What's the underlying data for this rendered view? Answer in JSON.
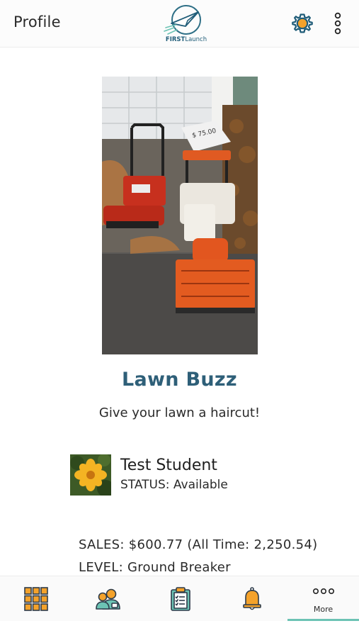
{
  "header": {
    "title": "Profile",
    "logo_text_bold": "FIRST",
    "logo_text_rest": "Launch"
  },
  "business": {
    "name": "Lawn Buzz",
    "tagline": "Give your lawn a haircut!"
  },
  "student": {
    "name": "Test Student",
    "status": "STATUS: Available"
  },
  "stats": {
    "sales": "SALES: $600.77 (All Time: 2,250.54)",
    "level": "LEVEL: Ground Breaker"
  },
  "bottom_nav": {
    "items": [
      {
        "icon": "grid-icon",
        "label": ""
      },
      {
        "icon": "team-icon",
        "label": ""
      },
      {
        "icon": "clipboard-icon",
        "label": ""
      },
      {
        "icon": "bell-icon",
        "label": ""
      },
      {
        "icon": "more-dots-icon",
        "label": "More"
      }
    ],
    "active_index": 4
  },
  "colors": {
    "accent": "#2e5f78",
    "nav_indicator": "#6cc3b4",
    "icon_orange": "#f4a22b",
    "icon_dark": "#2d3b4a"
  }
}
